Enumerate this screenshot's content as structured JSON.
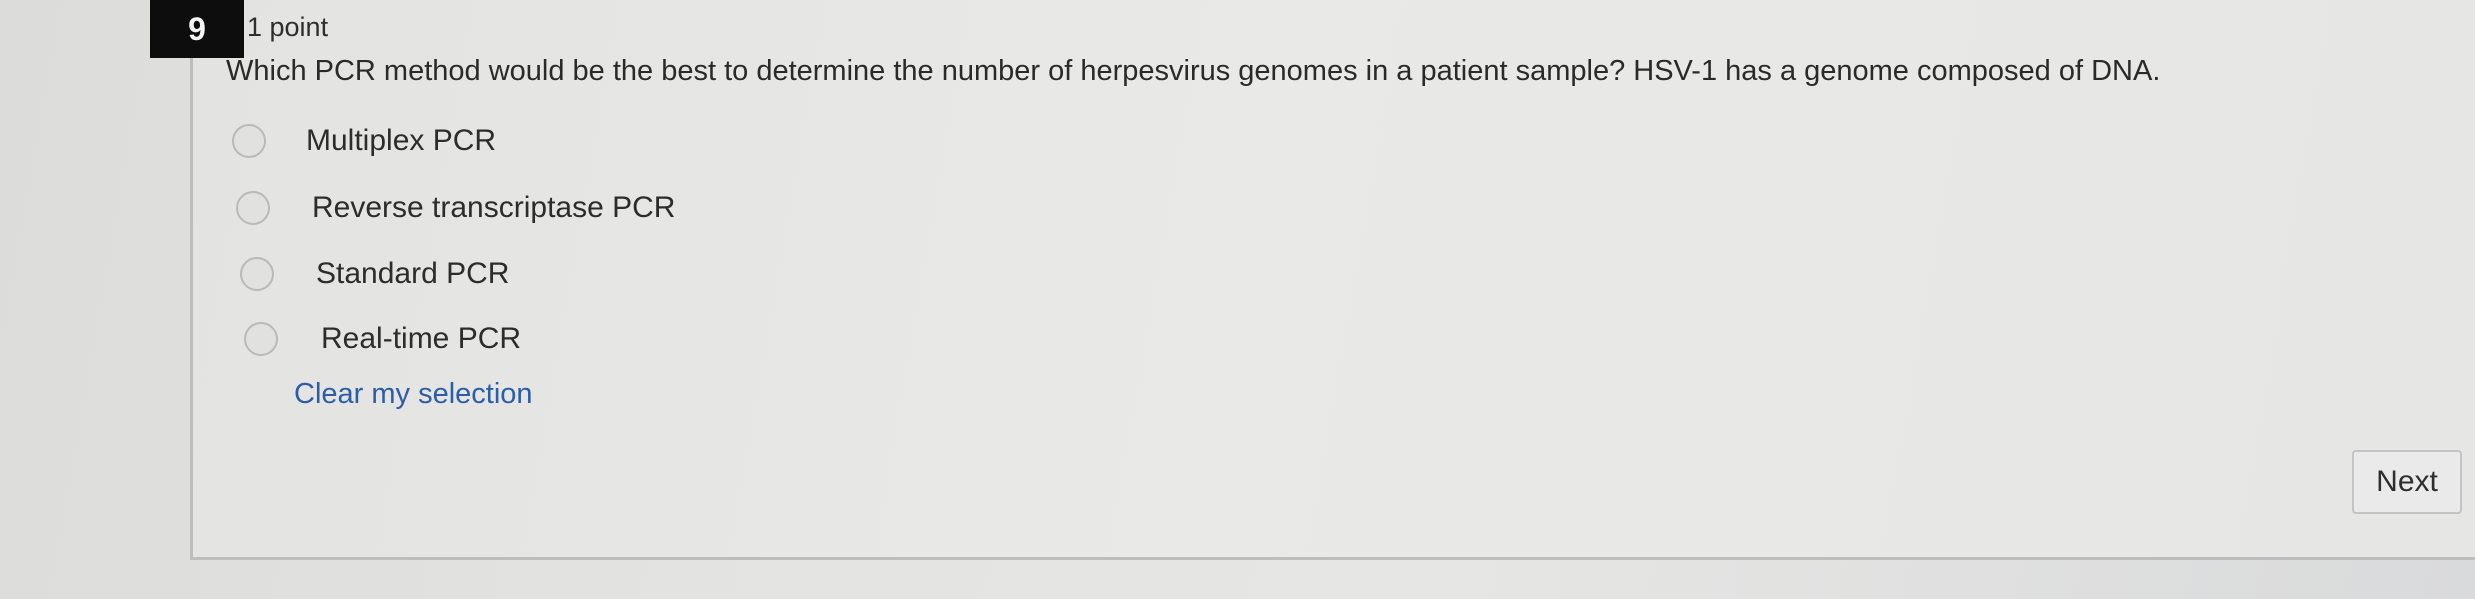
{
  "question": {
    "number": "9",
    "points": "1 point",
    "text": "Which PCR method would be the best to determine the number of herpesvirus genomes in a patient sample? HSV-1 has a genome composed of DNA.",
    "options": [
      {
        "label": "Multiplex PCR"
      },
      {
        "label": "Reverse transcriptase PCR"
      },
      {
        "label": "Standard PCR"
      },
      {
        "label": "Real-time PCR"
      }
    ],
    "clear_label": "Clear my selection"
  },
  "navigation": {
    "next_label": "Next"
  }
}
